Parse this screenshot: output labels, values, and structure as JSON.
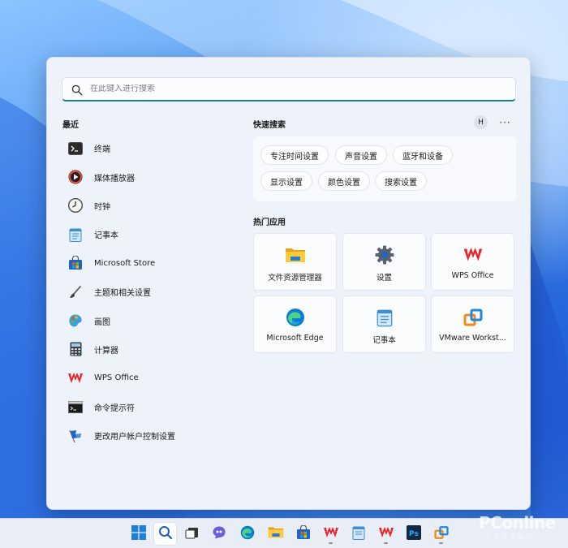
{
  "search": {
    "placeholder": "在此键入进行搜索"
  },
  "recent": {
    "title": "最近",
    "items": [
      {
        "label": "终端",
        "icon": "terminal-icon"
      },
      {
        "label": "媒体播放器",
        "icon": "media-player-icon"
      },
      {
        "label": "时钟",
        "icon": "clock-icon"
      },
      {
        "label": "记事本",
        "icon": "notepad-icon"
      },
      {
        "label": "Microsoft Store",
        "icon": "store-icon"
      },
      {
        "label": "主题和相关设置",
        "icon": "brush-icon"
      },
      {
        "label": "画图",
        "icon": "paint-icon"
      },
      {
        "label": "计算器",
        "icon": "calculator-icon"
      },
      {
        "label": "WPS Office",
        "icon": "wps-icon"
      },
      {
        "label": "命令提示符",
        "icon": "cmd-icon"
      },
      {
        "label": "更改用户帐户控制设置",
        "icon": "uac-flag-icon"
      }
    ]
  },
  "quick_search": {
    "title": "快速搜索",
    "avatar": "H",
    "more": "···",
    "chips": [
      "专注时间设置",
      "声音设置",
      "蓝牙和设备",
      "显示设置",
      "颜色设置",
      "搜索设置"
    ]
  },
  "top_apps": {
    "title": "热门应用",
    "items": [
      {
        "label": "文件资源管理器",
        "icon": "file-explorer-icon"
      },
      {
        "label": "设置",
        "icon": "settings-gear-icon"
      },
      {
        "label": "WPS Office",
        "icon": "wps-icon"
      },
      {
        "label": "Microsoft Edge",
        "icon": "edge-icon"
      },
      {
        "label": "记事本",
        "icon": "notepad-icon"
      },
      {
        "label": "VMware Workst...",
        "icon": "vmware-icon"
      }
    ]
  },
  "watermark": {
    "brand": "PConline",
    "sub": "太平洋电脑网"
  },
  "colors": {
    "accent": "#1a7f92",
    "wps_red": "#e8262a",
    "edge_blue": "#0c7bd4"
  }
}
